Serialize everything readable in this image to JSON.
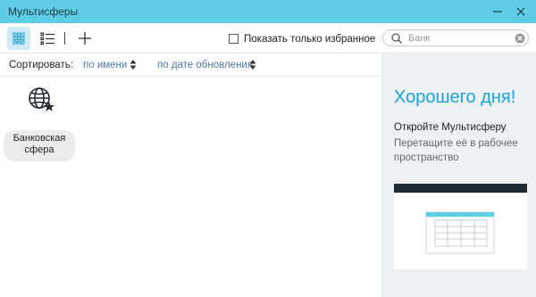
{
  "window": {
    "title": "Мультисферы"
  },
  "toolbar": {
    "favorites_label": "Показать только избранное",
    "search_placeholder": "Банк"
  },
  "sort": {
    "label": "Сортировать:",
    "by_name": "по имени",
    "by_date": "по дате обновления"
  },
  "spheres": [
    {
      "name": "Банковская сфера"
    }
  ],
  "panel": {
    "greeting": "Хорошего дня!",
    "open_title": "Откройте Мультисферу",
    "drag_hint": "Перетащите её в рабочее пространство"
  },
  "colors": {
    "titlebar": "#5ecde6",
    "accent": "#1aa3d4",
    "link": "#4f79a8",
    "panel_bg": "#eef1f4"
  }
}
